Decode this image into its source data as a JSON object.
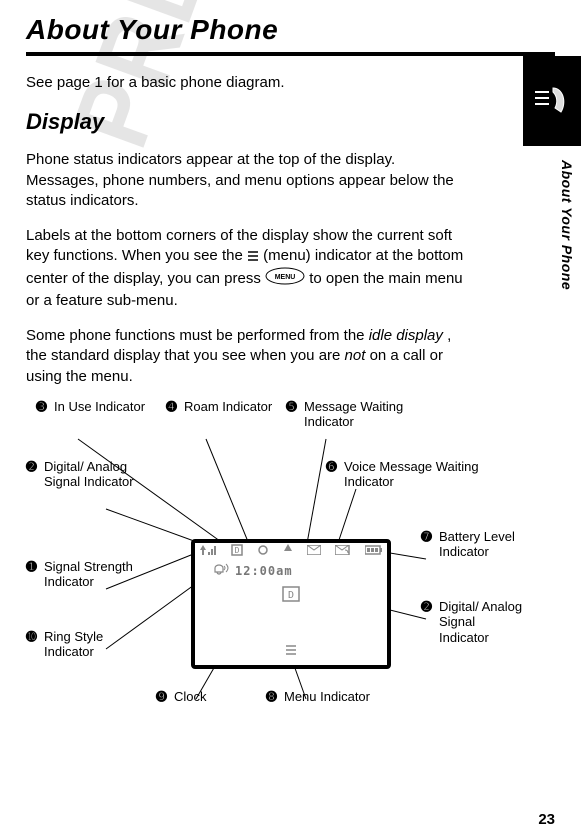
{
  "title": "About Your Phone",
  "intro": "See page 1 for a basic phone diagram.",
  "subhead": "Display",
  "para1": "Phone status indicators appear at the top of the display. Messages, phone numbers, and menu options appear below the status indicators.",
  "para2a": "Labels at the bottom corners of the display show the current soft key functions. When you see the ",
  "para2b": " (menu) indicator at the bottom center of the display, you can press ",
  "para2c": " to open the main menu or a feature sub-menu.",
  "para3a": "Some phone functions must be performed from the ",
  "para3_idle": "idle display",
  "para3b": ", the standard display that you see when you are ",
  "para3_not": "not",
  "para3c": " on a call or using the menu.",
  "side_label": "About Your Phone",
  "page_number": "23",
  "watermark": "PRELIMINARY",
  "menu_key_label": "MENU",
  "clock_value": "12:00am",
  "callouts": {
    "c1": {
      "num": "➊",
      "label": "Signal Strength Indicator"
    },
    "c2a": {
      "num": "➋",
      "label": "Digital/ Analog Signal Indicator"
    },
    "c2b": {
      "num": "➋",
      "label": "Digital/ Analog Signal Indicator"
    },
    "c3": {
      "num": "➌",
      "label": "In Use Indicator"
    },
    "c4": {
      "num": "➍",
      "label": "Roam Indicator"
    },
    "c5": {
      "num": "➎",
      "label": "Message Waiting Indicator"
    },
    "c6": {
      "num": "➏",
      "label": "Voice Message Waiting Indicator"
    },
    "c7": {
      "num": "➐",
      "label": "Battery Level Indicator"
    },
    "c8": {
      "num": "➑",
      "label": "Menu Indicator"
    },
    "c9": {
      "num": "➒",
      "label": "Clock"
    },
    "c10": {
      "num": "➓",
      "label": "Ring Style Indicator"
    }
  }
}
